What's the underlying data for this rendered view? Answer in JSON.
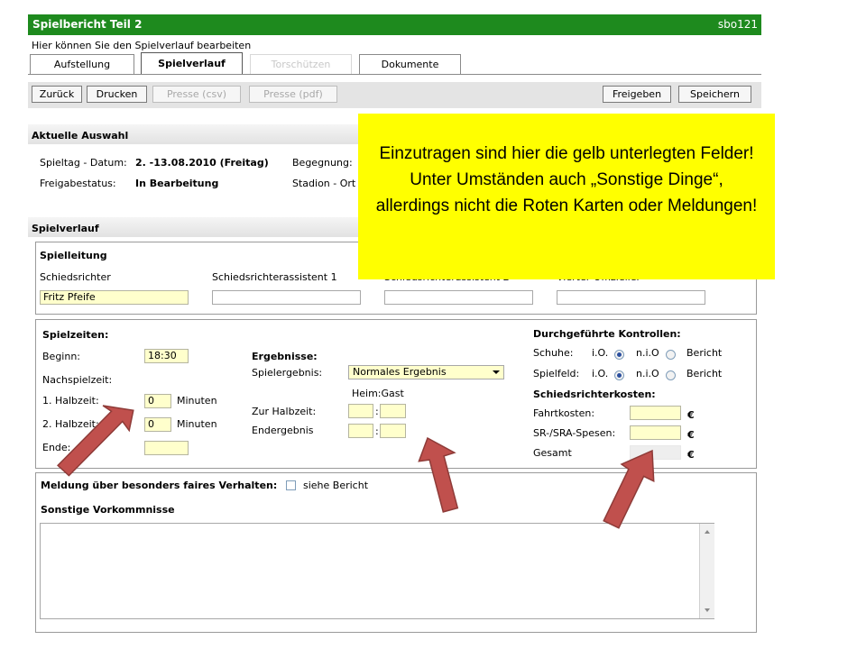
{
  "header": {
    "title": "Spielbericht Teil 2",
    "user": "sbo121"
  },
  "subtitle": "Hier können Sie den Spielverlauf bearbeiten",
  "tabs": [
    {
      "label": "Aufstellung"
    },
    {
      "label": "Spielverlauf"
    },
    {
      "label": "Torschützen"
    },
    {
      "label": "Dokumente"
    }
  ],
  "toolbar": {
    "back": "Zurück",
    "print": "Drucken",
    "press_csv": "Presse (csv)",
    "press_pdf": "Presse (pdf)",
    "release": "Freigeben",
    "save": "Speichern"
  },
  "current": {
    "title": "Aktuelle Auswahl",
    "matchday_label": "Spieltag - Datum:",
    "matchday_value": "2. -13.08.2010 (Freitag)",
    "fixture_label": "Begegnung:",
    "status_label": "Freigabestatus:",
    "status_value": "In Bearbeitung",
    "venue_label": "Stadion - Ort"
  },
  "verlauf": {
    "title": "Spielverlauf"
  },
  "spielleitung": {
    "title": "Spielleitung",
    "referee_label": "Schiedsrichter",
    "referee_value": "Fritz Pfeife",
    "assistant1_label": "Schiedsrichterassistent 1",
    "assistant2_label": "Schiedsrichterassistent 2",
    "fourth_label": "Vierter Offizieller"
  },
  "zeiten": {
    "title": "Spielzeiten:",
    "start_label": "Beginn:",
    "start_value": "18:30",
    "extra_label": "Nachspielzeit:",
    "half1_label": "1. Halbzeit:",
    "half1_value": "0",
    "half2_label": "2. Halbzeit:",
    "half2_value": "0",
    "minutes": "Minuten",
    "end_label": "Ende:"
  },
  "ergebnisse": {
    "title": "Ergebnisse:",
    "result_label": "Spielergebnis:",
    "result_value": "Normales Ergebnis",
    "home_away": "Heim:Gast",
    "halftime_label": "Zur Halbzeit:",
    "final_label": "Endergebnis",
    "colon": ":"
  },
  "kontrollen": {
    "title": "Durchgeführte Kontrollen:",
    "shoes_label": "Schuhe:",
    "field_label": "Spielfeld:",
    "ok": "i.O.",
    "nok": "n.i.O",
    "report": "Bericht"
  },
  "kosten": {
    "title": "Schiedsrichterkosten:",
    "travel_label": "Fahrtkosten:",
    "expenses_label": "SR-/SRA-Spesen:",
    "total_label": "Gesamt",
    "currency": "€"
  },
  "fairplay": {
    "label": "Meldung über besonders faires Verhalten:",
    "report": "siehe Bericht"
  },
  "other": {
    "title": "Sonstige Vorkommnisse"
  },
  "callout": {
    "text": "Einzutragen sind hier die gelb unterlegten Felder!  Unter Umständen auch „Sonstige Dinge“, allerdings nicht die Roten Karten oder Meldungen!"
  },
  "colors": {
    "header": "#1e8a1e",
    "highlight": "#ffffcc",
    "callout": "#ffff00",
    "arrow": "#c0504d"
  }
}
